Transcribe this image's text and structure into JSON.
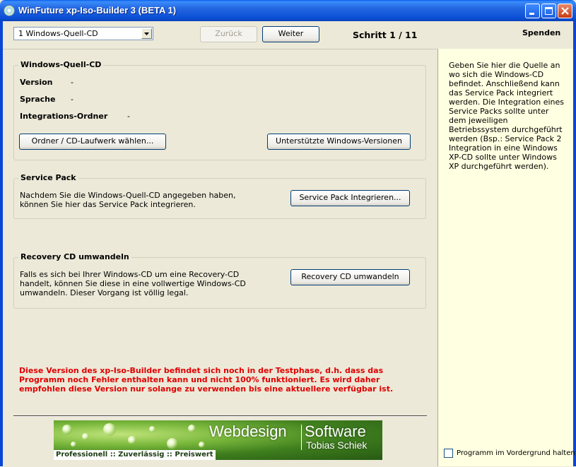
{
  "window": {
    "title": "WinFuture xp-Iso-Builder 3 (BETA 1)"
  },
  "toolbar": {
    "step_select_value": "1 Windows-Quell-CD",
    "back_label": "Zurück",
    "next_label": "Weiter",
    "step_text": "Schritt 1 / 11",
    "donate_label": "Spenden"
  },
  "source_group": {
    "title": "Windows-Quell-CD",
    "version_label": "Version",
    "version_value": "-",
    "language_label": "Sprache",
    "language_value": "-",
    "folder_label": "Integrations-Ordner",
    "folder_value": "-",
    "choose_button": "Ordner / CD-Laufwerk wählen...",
    "supported_button": "Unterstützte Windows-Versionen"
  },
  "sp_group": {
    "title": "Service Pack",
    "description": "Nachdem Sie die Windows-Quell-CD angegeben haben, können Sie hier das Service Pack integrieren.",
    "button": "Service Pack Integrieren..."
  },
  "recovery_group": {
    "title": "Recovery CD umwandeln",
    "description": "Falls es sich bei Ihrer Windows-CD um eine Recovery-CD handelt, können Sie diese in eine vollwertige Windows-CD umwandeln. Dieser Vorgang ist völlig legal.",
    "button": "Recovery CD umwandeln"
  },
  "warning_text": "Diese Version des xp-Iso-Builder befindet sich noch in der Testphase, d.h. dass das Programm noch Fehler enthalten kann und nicht 100% funktioniert. Es wird daher empfohlen diese Version nur solange zu verwenden bis eine aktuellere verfügbar ist.",
  "banner": {
    "brand_left": "Webdesign",
    "brand_right": "Software",
    "author": "Tobias Schiek",
    "slogan": "Professionell :: Zuverlässig :: Preiswert"
  },
  "sidebar": {
    "help_text": "Geben Sie hier die Quelle an wo sich die Windows-CD befindet. Anschließend kann das Service Pack integriert werden. Die Integration eines Service Packs sollte unter dem jeweiligen Betriebssystem durchgeführt werden (Bsp.: Service Pack 2 Integration in eine Windows XP-CD sollte unter Windows XP durchgeführt werden).",
    "always_on_top_label": "Programm im Vordergrund halten",
    "always_on_top_checked": false
  },
  "colors": {
    "titlebar": "#0A5FE8",
    "window_bg": "#ECE9D8",
    "sidebar_bg": "#FFFFE1",
    "warning": "#E00000"
  }
}
